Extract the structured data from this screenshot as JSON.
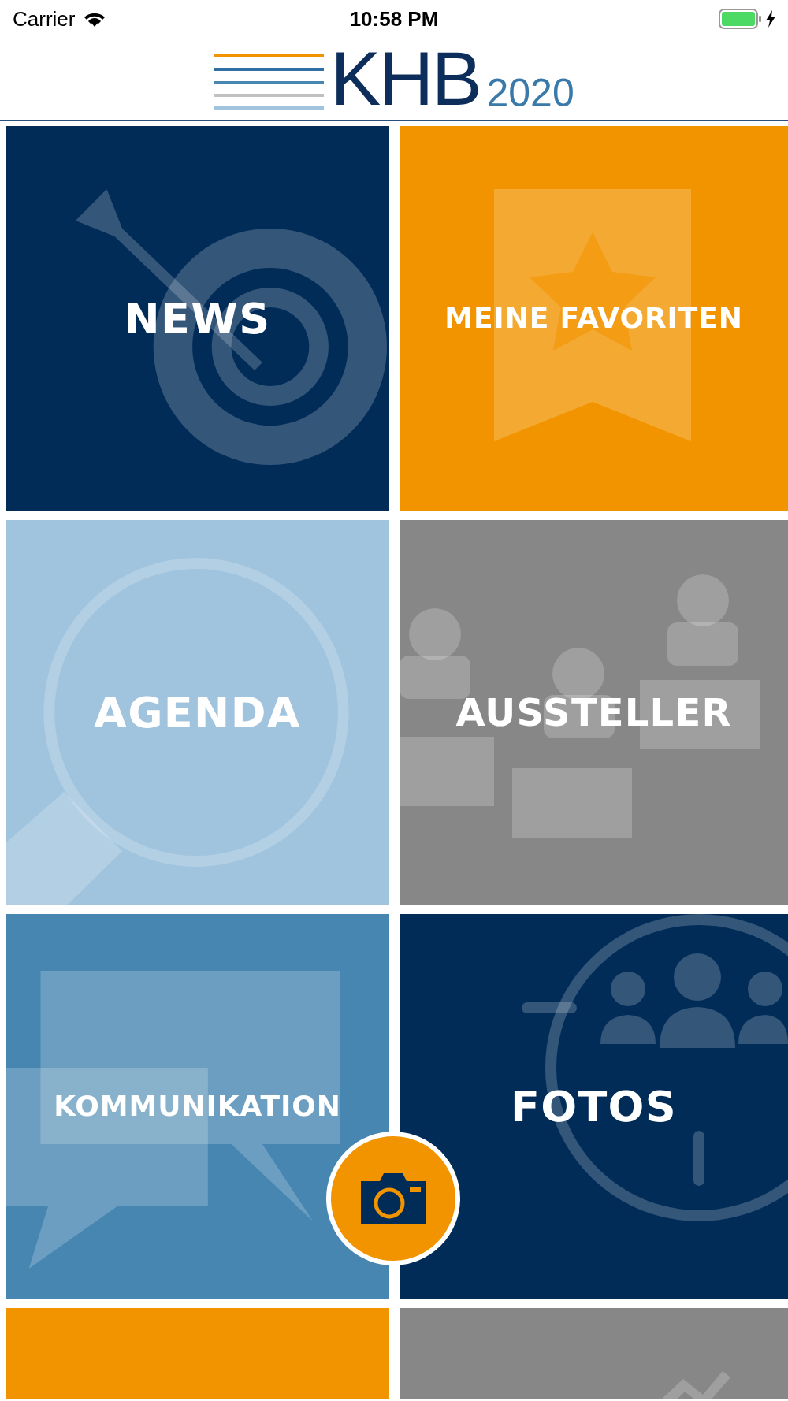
{
  "status_bar": {
    "carrier": "Carrier",
    "time": "10:58 PM"
  },
  "logo": {
    "name": "KHB",
    "year": "2020"
  },
  "tiles": [
    {
      "label": "NEWS",
      "color": "#012c58",
      "kind": "target"
    },
    {
      "label": "MEINE FAVORITEN",
      "color": "#f29400",
      "kind": "bookmark"
    },
    {
      "label": "AGENDA",
      "color": "#a0c3de",
      "kind": "magnifier"
    },
    {
      "label": "AUSSTELLER",
      "color": "#878787",
      "kind": "booths"
    },
    {
      "label": "KOMMUNIKATION",
      "color": "#4686b1",
      "kind": "chat"
    },
    {
      "label": "FOTOS",
      "color": "#012c58",
      "kind": "group"
    },
    {
      "color": "#f29400",
      "kind": "blank"
    },
    {
      "color": "#878787",
      "kind": "partial"
    }
  ]
}
